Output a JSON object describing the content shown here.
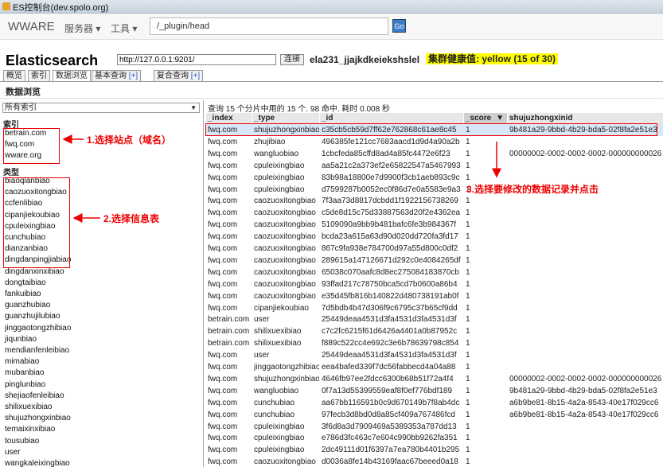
{
  "window": {
    "title": "ES控制台(dev.spolo.org)"
  },
  "navbar": {
    "brand": "WWARE",
    "menu_services": "服务器",
    "menu_tools": "工具",
    "path_value": "/_plugin/head",
    "go_label": "Go"
  },
  "head": {
    "title": "Elasticsearch",
    "url_value": "http://127.0.0.1:9201/",
    "connect_label": "连接",
    "cluster_name": "ela231_jjajkdkeiekshslel",
    "health": "集群健康值: yellow (15 of 30)"
  },
  "tabs": [
    {
      "label": "概览"
    },
    {
      "label": "索引"
    },
    {
      "label": "数据浏览"
    },
    {
      "label": "基本查询",
      "plus": "[+]"
    },
    {
      "label": "复合查询",
      "plus": "[+]"
    }
  ],
  "section_title": "数据浏览",
  "sidebar": {
    "index_select": "所有索引",
    "index_heading": "索引",
    "indices": [
      "betrain.com",
      "fwq.com",
      "wware.org"
    ],
    "type_heading": "类型",
    "types": [
      "biaoqianbiao",
      "caozuoxitongbiao",
      "ccfenlibiao",
      "cipanjiekoubiao",
      "cpuleixingbiao",
      "cunchubiao",
      "dianzanbiao",
      "dingdanpingjiabiao",
      "dingdanxinxibiao",
      "dongtaibiao",
      "fankuibiao",
      "guanzhubiao",
      "guanzhujilubiao",
      "jinggaotongzhibiao",
      "jiqunbiao",
      "mendianfenleibiao",
      "mimabiao",
      "mubanbiao",
      "pinglunbiao",
      "shejiaofenleibiao",
      "shilixuexibiao",
      "shujuzhongxinbiao",
      "temaixinxibiao",
      "tousubiao",
      "user",
      "wangkaleixingbiao"
    ]
  },
  "annotations": {
    "step1": "1.选择站点（域名）",
    "step2": "2.选择信息表",
    "step3": "3.选择要修改的数据记录并点击"
  },
  "results": {
    "query_info": "查询 15 个分片中用的 15 个. 98 命中. 耗时 0.008 秒",
    "columns": [
      "_index",
      "_type",
      "_id",
      "_score",
      "shujuzhongxinid"
    ],
    "sort_indicator": "▼",
    "rows": [
      [
        "fwq.com",
        "shujuzhongxinbiao",
        "c35cb5cb59d7ff62e762868c61ae8c45",
        "1",
        "9b481a29-9bbd-4b29-bda5-02f8fa2e51e3"
      ],
      [
        "fwq.com",
        "zhujibiao",
        "496385fe121cc7683aacd1d9d4a90a2b",
        "1",
        ""
      ],
      [
        "fwq.com",
        "wangluobiao",
        "1cbcfeda85cffd8ad4a85fc4472e6f23",
        "1",
        "00000002-0002-0002-0002-000000000026"
      ],
      [
        "fwq.com",
        "cpuleixingbiao",
        "aa5a21c2a373ef2e65822547a5467993",
        "1",
        ""
      ],
      [
        "fwq.com",
        "cpuleixingbiao",
        "83b98a18800e7d9900f3cb1aeb893c9c",
        "1",
        ""
      ],
      [
        "fwq.com",
        "cpuleixingbiao",
        "d7599287b0052ec0f86d7e0a5583e9a3",
        "1",
        ""
      ],
      [
        "fwq.com",
        "caozuoxitongbiao",
        "7f3aa73d8817dcbdd1f1922156738269",
        "1",
        ""
      ],
      [
        "fwq.com",
        "caozuoxitongbiao",
        "c5de8d15c75d33887563d20f2e4362ea",
        "1",
        ""
      ],
      [
        "fwq.com",
        "caozuoxitongbiao",
        "5109090a9bb9b481bafc6fe3b984367f",
        "1",
        ""
      ],
      [
        "fwq.com",
        "caozuoxitongbiao",
        "bcda23a615a63d90d020dd720fa3fd17",
        "1",
        ""
      ],
      [
        "fwq.com",
        "caozuoxitongbiao",
        "867c9fa938e784700d97a55d800c0df2",
        "1",
        ""
      ],
      [
        "fwq.com",
        "caozuoxitongbiao",
        "289615a147126671d292c0e4084265df",
        "1",
        ""
      ],
      [
        "fwq.com",
        "caozuoxitongbiao",
        "65038c070aafc8d8ec275084183870cb",
        "1",
        ""
      ],
      [
        "fwq.com",
        "caozuoxitongbiao",
        "93ffad217c78750bca5cd7b0600a86b4",
        "1",
        ""
      ],
      [
        "fwq.com",
        "caozuoxitongbiao",
        "e35d45fb816b140822d480738191ab0f",
        "1",
        ""
      ],
      [
        "fwq.com",
        "cipanjiekoubiao",
        "7d5bdb4b47d306f9c6795c37b65cf9dd",
        "1",
        ""
      ],
      [
        "betrain.com",
        "user",
        "25449deaa4531d3fa4531d3fa4531d3f",
        "1",
        ""
      ],
      [
        "betrain.com",
        "shilixuexibiao",
        "c7c2fc6215f61d6426a4401a0b87952c",
        "1",
        ""
      ],
      [
        "betrain.com",
        "shilixuexibiao",
        "f889c522cc4e692c3e6b78639798c854",
        "1",
        ""
      ],
      [
        "fwq.com",
        "user",
        "25449deaa4531d3fa4531d3fa4531d3f",
        "1",
        ""
      ],
      [
        "fwq.com",
        "jinggaotongzhibiao",
        "eea4bafed339f7dc56fabbecd4a04a88",
        "1",
        ""
      ],
      [
        "fwq.com",
        "shujuzhongxinbiao",
        "4646fb97ee2fdcc6300b68b51f72a4f4",
        "1",
        "00000002-0002-0002-0002-000000000026"
      ],
      [
        "fwq.com",
        "wangluobiao",
        "0f7a13d55399559eaf8f0ef776bdf189",
        "1",
        "9b481a29-9bbd-4b29-bda5-02f8fa2e51e3"
      ],
      [
        "fwq.com",
        "cunchubiao",
        "aa67bb116591b0c9d670149b7f8ab4dc",
        "1",
        "a6b9be81-8b15-4a2a-8543-40e17f029cc6"
      ],
      [
        "fwq.com",
        "cunchubiao",
        "97fecb3d8bd0d8a85cf409a767486fcd",
        "1",
        "a6b9be81-8b15-4a2a-8543-40e17f029cc6"
      ],
      [
        "fwq.com",
        "cpuleixingbiao",
        "3f6d8a3d7909469a5389353a787dd13",
        "1",
        ""
      ],
      [
        "fwq.com",
        "cpuleixingbiao",
        "e786d3fc463c7e604c990bb9262fa351",
        "1",
        ""
      ],
      [
        "fwq.com",
        "cpuleixingbiao",
        "2dc49111d01f6397a7ea780b4401b295",
        "1",
        ""
      ],
      [
        "fwq.com",
        "caozuoxitongbiao",
        "d0036a8fe14b43169faac67beeed0a18",
        "1",
        ""
      ]
    ]
  },
  "colors": {
    "annotation_red": "#ee0000",
    "health_yellow": "#ffff00",
    "selected_row": "#d9e6f7"
  }
}
